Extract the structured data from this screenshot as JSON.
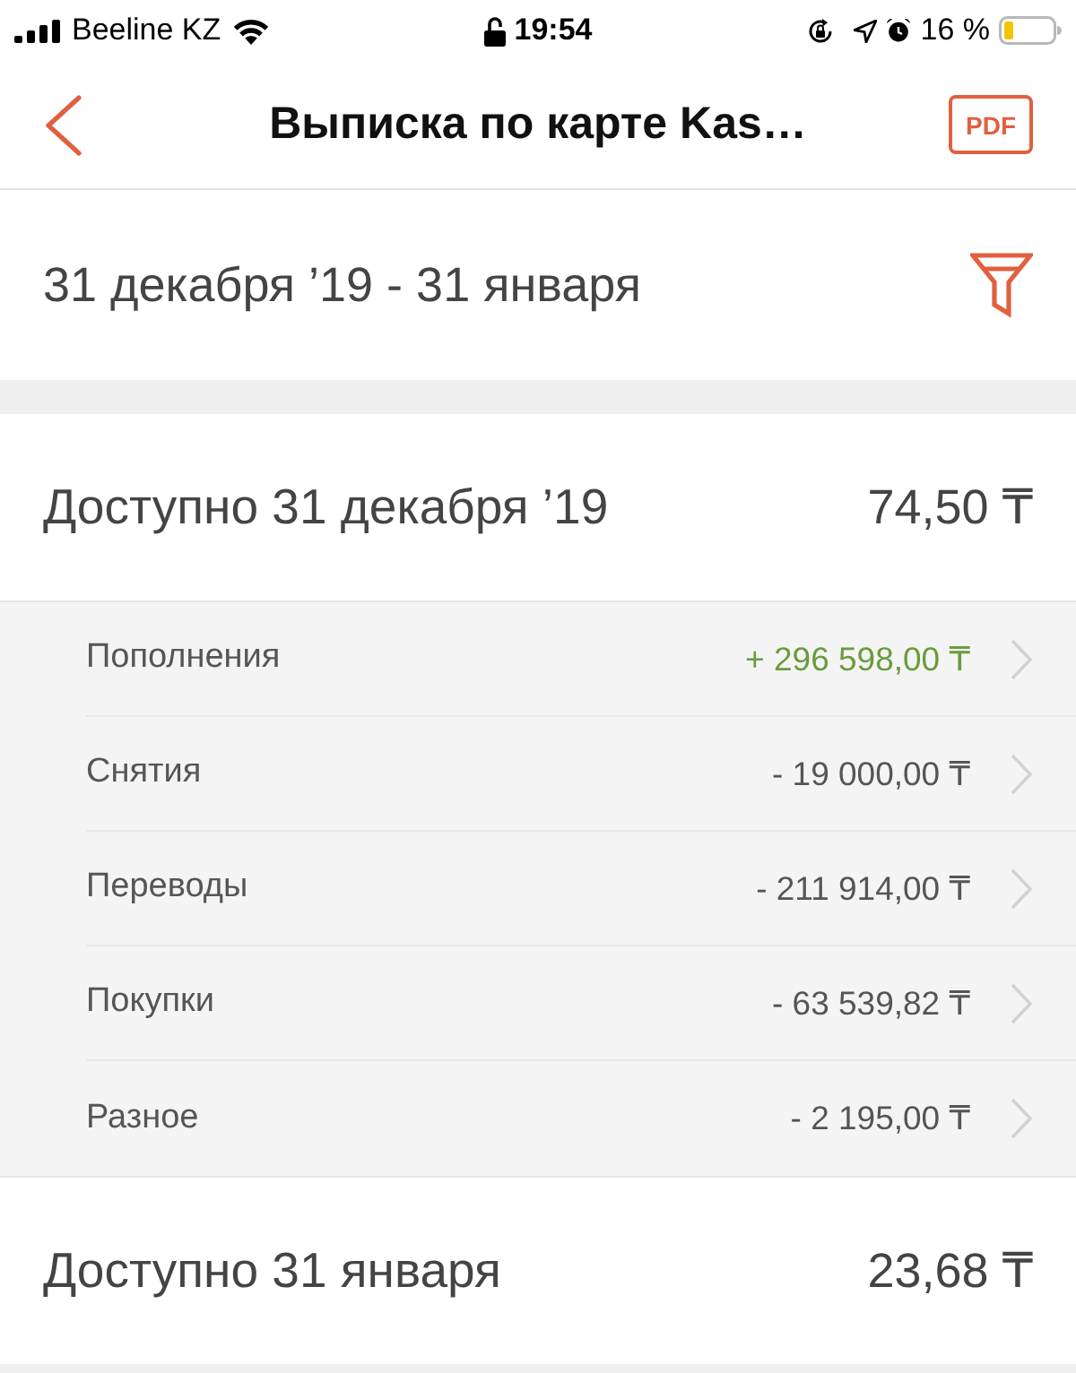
{
  "status_bar": {
    "carrier": "Beeline KZ",
    "time": "19:54",
    "battery_percent": "16 %"
  },
  "nav_bar": {
    "title": "Выписка по карте Kas…",
    "pdf_button": "PDF"
  },
  "period": {
    "range": "31 декабря ’19 - 31 января"
  },
  "opening_balance": {
    "label": "Доступно 31 декабря ’19",
    "amount": "74,50 ₸"
  },
  "categories": [
    {
      "name": "Пополнения",
      "amount": "+ 296 598,00 ₸",
      "kind": "credit"
    },
    {
      "name": "Снятия",
      "amount": "- 19 000,00 ₸",
      "kind": "debit"
    },
    {
      "name": "Переводы",
      "amount": "- 211 914,00 ₸",
      "kind": "debit"
    },
    {
      "name": "Покупки",
      "amount": "- 63 539,82 ₸",
      "kind": "debit"
    },
    {
      "name": "Разное",
      "amount": "- 2 195,00 ₸",
      "kind": "debit"
    }
  ],
  "closing_balance": {
    "label": "Доступно 31 января",
    "amount": "23,68 ₸"
  }
}
